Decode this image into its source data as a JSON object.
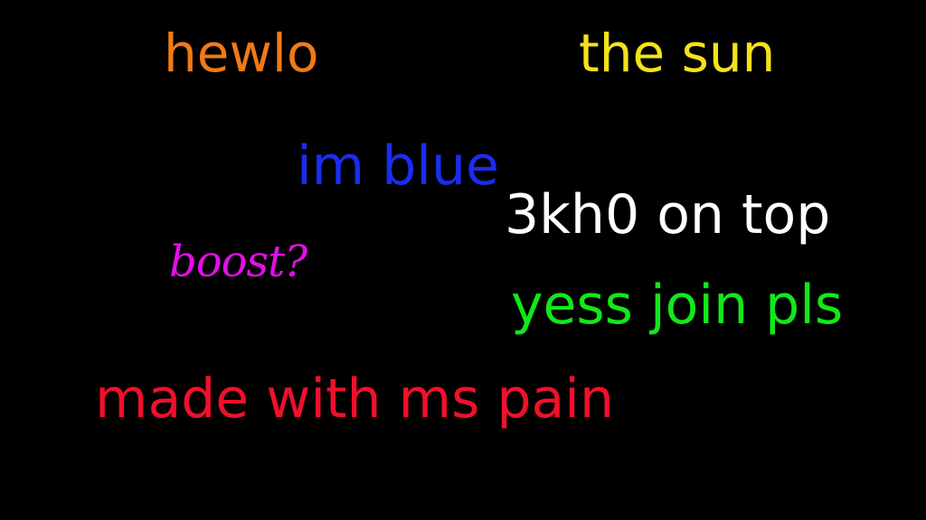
{
  "texts": {
    "hewlo": "hewlo",
    "the_sun": "the sun",
    "im_blue": "im blue",
    "khzero": "3kh0 on top",
    "boost": "boost?",
    "yess": "yess join pls",
    "made_with": "made with ms pain"
  },
  "colors": {
    "background": "#000000",
    "hewlo": "#f07a18",
    "the_sun": "#f5e21a",
    "im_blue": "#1a2cf0",
    "khzero": "#ffffff",
    "boost": "#e010e8",
    "yess": "#12e81a",
    "made_with": "#f0102c"
  }
}
